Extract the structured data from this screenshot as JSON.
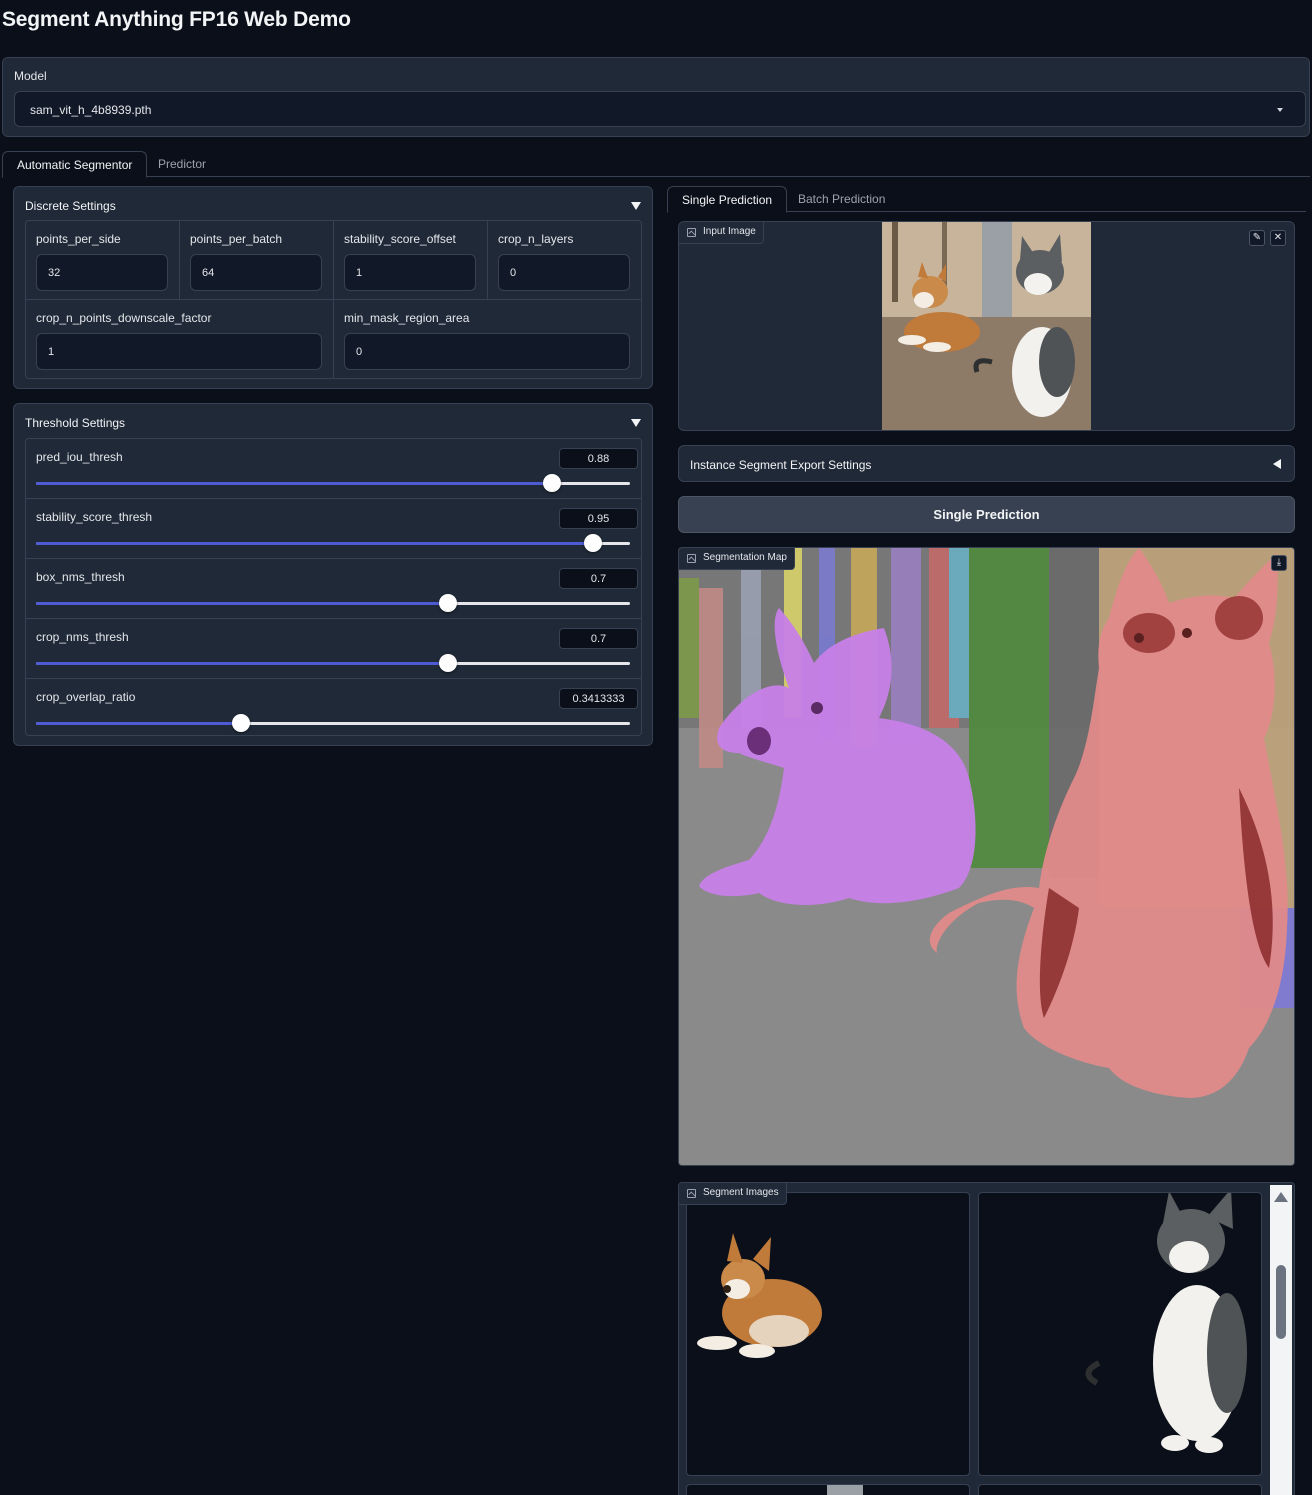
{
  "app": {
    "title": "Segment Anything FP16 Web Demo"
  },
  "model": {
    "label": "Model",
    "selected": "sam_vit_h_4b8939.pth"
  },
  "main_tabs": [
    {
      "label": "Automatic Segmentor",
      "active": true
    },
    {
      "label": "Predictor",
      "active": false
    }
  ],
  "discrete": {
    "title": "Discrete Settings",
    "fields": [
      {
        "label": "points_per_side",
        "value": "32"
      },
      {
        "label": "points_per_batch",
        "value": "64"
      },
      {
        "label": "stability_score_offset",
        "value": "1"
      },
      {
        "label": "crop_n_layers",
        "value": "0"
      },
      {
        "label": "crop_n_points_downscale_factor",
        "value": "1"
      },
      {
        "label": "min_mask_region_area",
        "value": "0"
      }
    ]
  },
  "threshold": {
    "title": "Threshold Settings",
    "sliders": [
      {
        "label": "pred_iou_thresh",
        "value": "0.88",
        "fraction": 0.868
      },
      {
        "label": "stability_score_thresh",
        "value": "0.95",
        "fraction": 0.937
      },
      {
        "label": "box_nms_thresh",
        "value": "0.7",
        "fraction": 0.694
      },
      {
        "label": "crop_nms_thresh",
        "value": "0.7",
        "fraction": 0.694
      },
      {
        "label": "crop_overlap_ratio",
        "value": "0.3413333",
        "fraction": 0.345
      }
    ]
  },
  "right_tabs": [
    {
      "label": "Single Prediction",
      "active": true
    },
    {
      "label": "Batch Prediction",
      "active": false
    }
  ],
  "input_image": {
    "label": "Input Image",
    "edit_icon": "pencil-icon",
    "close_icon": "close-icon"
  },
  "export_settings": {
    "title": "Instance Segment Export Settings"
  },
  "run_button": {
    "label": "Single Prediction"
  },
  "segmentation_map": {
    "label": "Segmentation Map",
    "download_icon": "download-icon"
  },
  "segment_images": {
    "label": "Segment Images"
  },
  "colors": {
    "background": "#0b0f19",
    "panel": "#1f2937",
    "border": "#374151",
    "slider_fill": "#4f5bd5",
    "dog_mask": "#c780e8",
    "cat_mask": "#e08a8a"
  }
}
